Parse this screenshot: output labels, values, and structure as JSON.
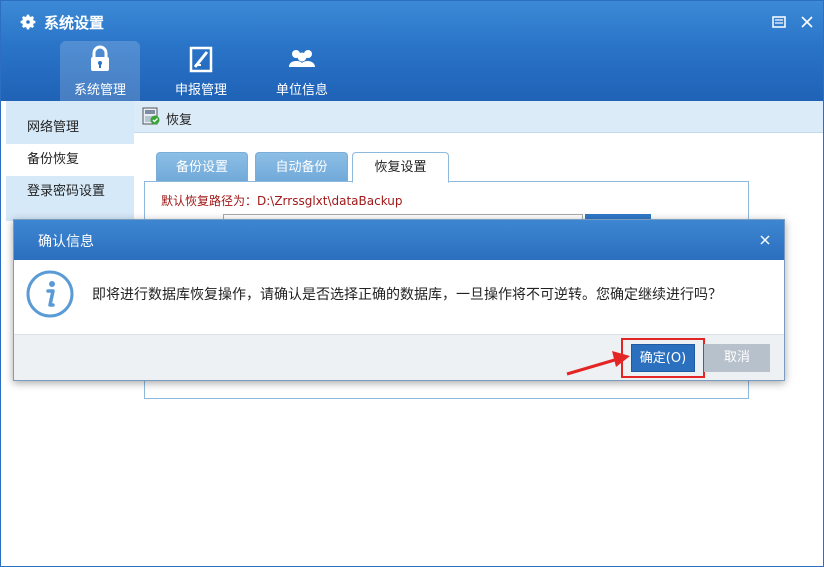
{
  "window": {
    "title": "系统设置"
  },
  "nav_tabs": [
    {
      "label": "系统管理",
      "icon": "lock-icon"
    },
    {
      "label": "申报管理",
      "icon": "edit-form-icon"
    },
    {
      "label": "单位信息",
      "icon": "users-icon"
    }
  ],
  "sidebar": {
    "items": [
      {
        "label": "网络管理"
      },
      {
        "label": "备份恢复"
      },
      {
        "label": "登录密码设置"
      }
    ]
  },
  "content": {
    "header": "恢复",
    "subtabs": [
      {
        "label": "备份设置"
      },
      {
        "label": "自动备份"
      },
      {
        "label": "恢复设置"
      }
    ],
    "path_text": "默认恢复路径为：D:\\Zrrssglxt\\dataBackup"
  },
  "dialog": {
    "title": "确认信息",
    "message": "即将进行数据库恢复操作，请确认是否选择正确的数据库，一旦操作将不可逆转。您确定继续进行吗？",
    "ok_label": "确定(O)",
    "cancel_label": "取消"
  },
  "colors": {
    "accent": "#2b6fbf",
    "highlight_frame": "#e32525",
    "path_text": "#a01818"
  }
}
